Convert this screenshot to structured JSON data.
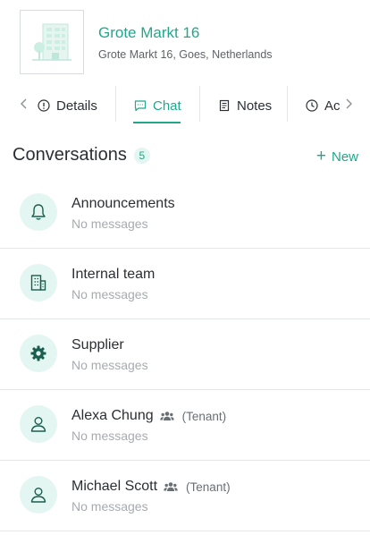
{
  "property": {
    "title": "Grote Markt 16",
    "address": "Grote Markt 16, Goes, Netherlands"
  },
  "tabs": [
    {
      "label": "Details",
      "icon": "info-circle-icon",
      "active": false
    },
    {
      "label": "Chat",
      "icon": "chat-bubble-icon",
      "active": true
    },
    {
      "label": "Notes",
      "icon": "notes-icon",
      "active": false
    },
    {
      "label": "Ac",
      "icon": "clock-icon",
      "active": false
    }
  ],
  "conversations": {
    "title": "Conversations",
    "count": "5",
    "new_label": "New",
    "items": [
      {
        "name": "Announcements",
        "subtitle": "No messages",
        "icon": "bell-icon",
        "role": ""
      },
      {
        "name": "Internal team",
        "subtitle": "No messages",
        "icon": "building-icon",
        "role": ""
      },
      {
        "name": "Supplier",
        "subtitle": "No messages",
        "icon": "gear-icon",
        "role": ""
      },
      {
        "name": "Alexa Chung",
        "subtitle": "No messages",
        "icon": "user-icon",
        "role": "(Tenant)"
      },
      {
        "name": "Michael Scott",
        "subtitle": "No messages",
        "icon": "user-icon",
        "role": "(Tenant)"
      }
    ]
  },
  "colors": {
    "accent": "#1fa88a",
    "accent_bg": "#e3f6f1",
    "text": "#2b2f33",
    "muted": "#a7abaf"
  }
}
